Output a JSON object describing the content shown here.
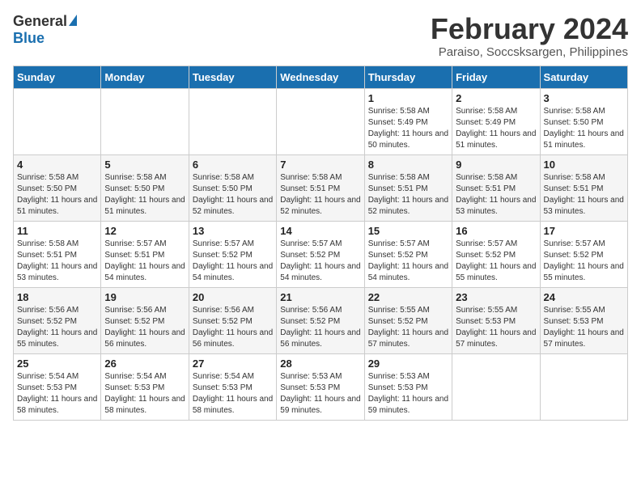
{
  "logo": {
    "general": "General",
    "blue": "Blue"
  },
  "title": {
    "month": "February 2024",
    "location": "Paraiso, Soccsksargen, Philippines"
  },
  "headers": [
    "Sunday",
    "Monday",
    "Tuesday",
    "Wednesday",
    "Thursday",
    "Friday",
    "Saturday"
  ],
  "weeks": [
    [
      {
        "day": "",
        "sunrise": "",
        "sunset": "",
        "daylight": ""
      },
      {
        "day": "",
        "sunrise": "",
        "sunset": "",
        "daylight": ""
      },
      {
        "day": "",
        "sunrise": "",
        "sunset": "",
        "daylight": ""
      },
      {
        "day": "",
        "sunrise": "",
        "sunset": "",
        "daylight": ""
      },
      {
        "day": "1",
        "sunrise": "Sunrise: 5:58 AM",
        "sunset": "Sunset: 5:49 PM",
        "daylight": "Daylight: 11 hours and 50 minutes."
      },
      {
        "day": "2",
        "sunrise": "Sunrise: 5:58 AM",
        "sunset": "Sunset: 5:49 PM",
        "daylight": "Daylight: 11 hours and 51 minutes."
      },
      {
        "day": "3",
        "sunrise": "Sunrise: 5:58 AM",
        "sunset": "Sunset: 5:50 PM",
        "daylight": "Daylight: 11 hours and 51 minutes."
      }
    ],
    [
      {
        "day": "4",
        "sunrise": "Sunrise: 5:58 AM",
        "sunset": "Sunset: 5:50 PM",
        "daylight": "Daylight: 11 hours and 51 minutes."
      },
      {
        "day": "5",
        "sunrise": "Sunrise: 5:58 AM",
        "sunset": "Sunset: 5:50 PM",
        "daylight": "Daylight: 11 hours and 51 minutes."
      },
      {
        "day": "6",
        "sunrise": "Sunrise: 5:58 AM",
        "sunset": "Sunset: 5:50 PM",
        "daylight": "Daylight: 11 hours and 52 minutes."
      },
      {
        "day": "7",
        "sunrise": "Sunrise: 5:58 AM",
        "sunset": "Sunset: 5:51 PM",
        "daylight": "Daylight: 11 hours and 52 minutes."
      },
      {
        "day": "8",
        "sunrise": "Sunrise: 5:58 AM",
        "sunset": "Sunset: 5:51 PM",
        "daylight": "Daylight: 11 hours and 52 minutes."
      },
      {
        "day": "9",
        "sunrise": "Sunrise: 5:58 AM",
        "sunset": "Sunset: 5:51 PM",
        "daylight": "Daylight: 11 hours and 53 minutes."
      },
      {
        "day": "10",
        "sunrise": "Sunrise: 5:58 AM",
        "sunset": "Sunset: 5:51 PM",
        "daylight": "Daylight: 11 hours and 53 minutes."
      }
    ],
    [
      {
        "day": "11",
        "sunrise": "Sunrise: 5:58 AM",
        "sunset": "Sunset: 5:51 PM",
        "daylight": "Daylight: 11 hours and 53 minutes."
      },
      {
        "day": "12",
        "sunrise": "Sunrise: 5:57 AM",
        "sunset": "Sunset: 5:51 PM",
        "daylight": "Daylight: 11 hours and 54 minutes."
      },
      {
        "day": "13",
        "sunrise": "Sunrise: 5:57 AM",
        "sunset": "Sunset: 5:52 PM",
        "daylight": "Daylight: 11 hours and 54 minutes."
      },
      {
        "day": "14",
        "sunrise": "Sunrise: 5:57 AM",
        "sunset": "Sunset: 5:52 PM",
        "daylight": "Daylight: 11 hours and 54 minutes."
      },
      {
        "day": "15",
        "sunrise": "Sunrise: 5:57 AM",
        "sunset": "Sunset: 5:52 PM",
        "daylight": "Daylight: 11 hours and 54 minutes."
      },
      {
        "day": "16",
        "sunrise": "Sunrise: 5:57 AM",
        "sunset": "Sunset: 5:52 PM",
        "daylight": "Daylight: 11 hours and 55 minutes."
      },
      {
        "day": "17",
        "sunrise": "Sunrise: 5:57 AM",
        "sunset": "Sunset: 5:52 PM",
        "daylight": "Daylight: 11 hours and 55 minutes."
      }
    ],
    [
      {
        "day": "18",
        "sunrise": "Sunrise: 5:56 AM",
        "sunset": "Sunset: 5:52 PM",
        "daylight": "Daylight: 11 hours and 55 minutes."
      },
      {
        "day": "19",
        "sunrise": "Sunrise: 5:56 AM",
        "sunset": "Sunset: 5:52 PM",
        "daylight": "Daylight: 11 hours and 56 minutes."
      },
      {
        "day": "20",
        "sunrise": "Sunrise: 5:56 AM",
        "sunset": "Sunset: 5:52 PM",
        "daylight": "Daylight: 11 hours and 56 minutes."
      },
      {
        "day": "21",
        "sunrise": "Sunrise: 5:56 AM",
        "sunset": "Sunset: 5:52 PM",
        "daylight": "Daylight: 11 hours and 56 minutes."
      },
      {
        "day": "22",
        "sunrise": "Sunrise: 5:55 AM",
        "sunset": "Sunset: 5:52 PM",
        "daylight": "Daylight: 11 hours and 57 minutes."
      },
      {
        "day": "23",
        "sunrise": "Sunrise: 5:55 AM",
        "sunset": "Sunset: 5:53 PM",
        "daylight": "Daylight: 11 hours and 57 minutes."
      },
      {
        "day": "24",
        "sunrise": "Sunrise: 5:55 AM",
        "sunset": "Sunset: 5:53 PM",
        "daylight": "Daylight: 11 hours and 57 minutes."
      }
    ],
    [
      {
        "day": "25",
        "sunrise": "Sunrise: 5:54 AM",
        "sunset": "Sunset: 5:53 PM",
        "daylight": "Daylight: 11 hours and 58 minutes."
      },
      {
        "day": "26",
        "sunrise": "Sunrise: 5:54 AM",
        "sunset": "Sunset: 5:53 PM",
        "daylight": "Daylight: 11 hours and 58 minutes."
      },
      {
        "day": "27",
        "sunrise": "Sunrise: 5:54 AM",
        "sunset": "Sunset: 5:53 PM",
        "daylight": "Daylight: 11 hours and 58 minutes."
      },
      {
        "day": "28",
        "sunrise": "Sunrise: 5:53 AM",
        "sunset": "Sunset: 5:53 PM",
        "daylight": "Daylight: 11 hours and 59 minutes."
      },
      {
        "day": "29",
        "sunrise": "Sunrise: 5:53 AM",
        "sunset": "Sunset: 5:53 PM",
        "daylight": "Daylight: 11 hours and 59 minutes."
      },
      {
        "day": "",
        "sunrise": "",
        "sunset": "",
        "daylight": ""
      },
      {
        "day": "",
        "sunrise": "",
        "sunset": "",
        "daylight": ""
      }
    ]
  ]
}
